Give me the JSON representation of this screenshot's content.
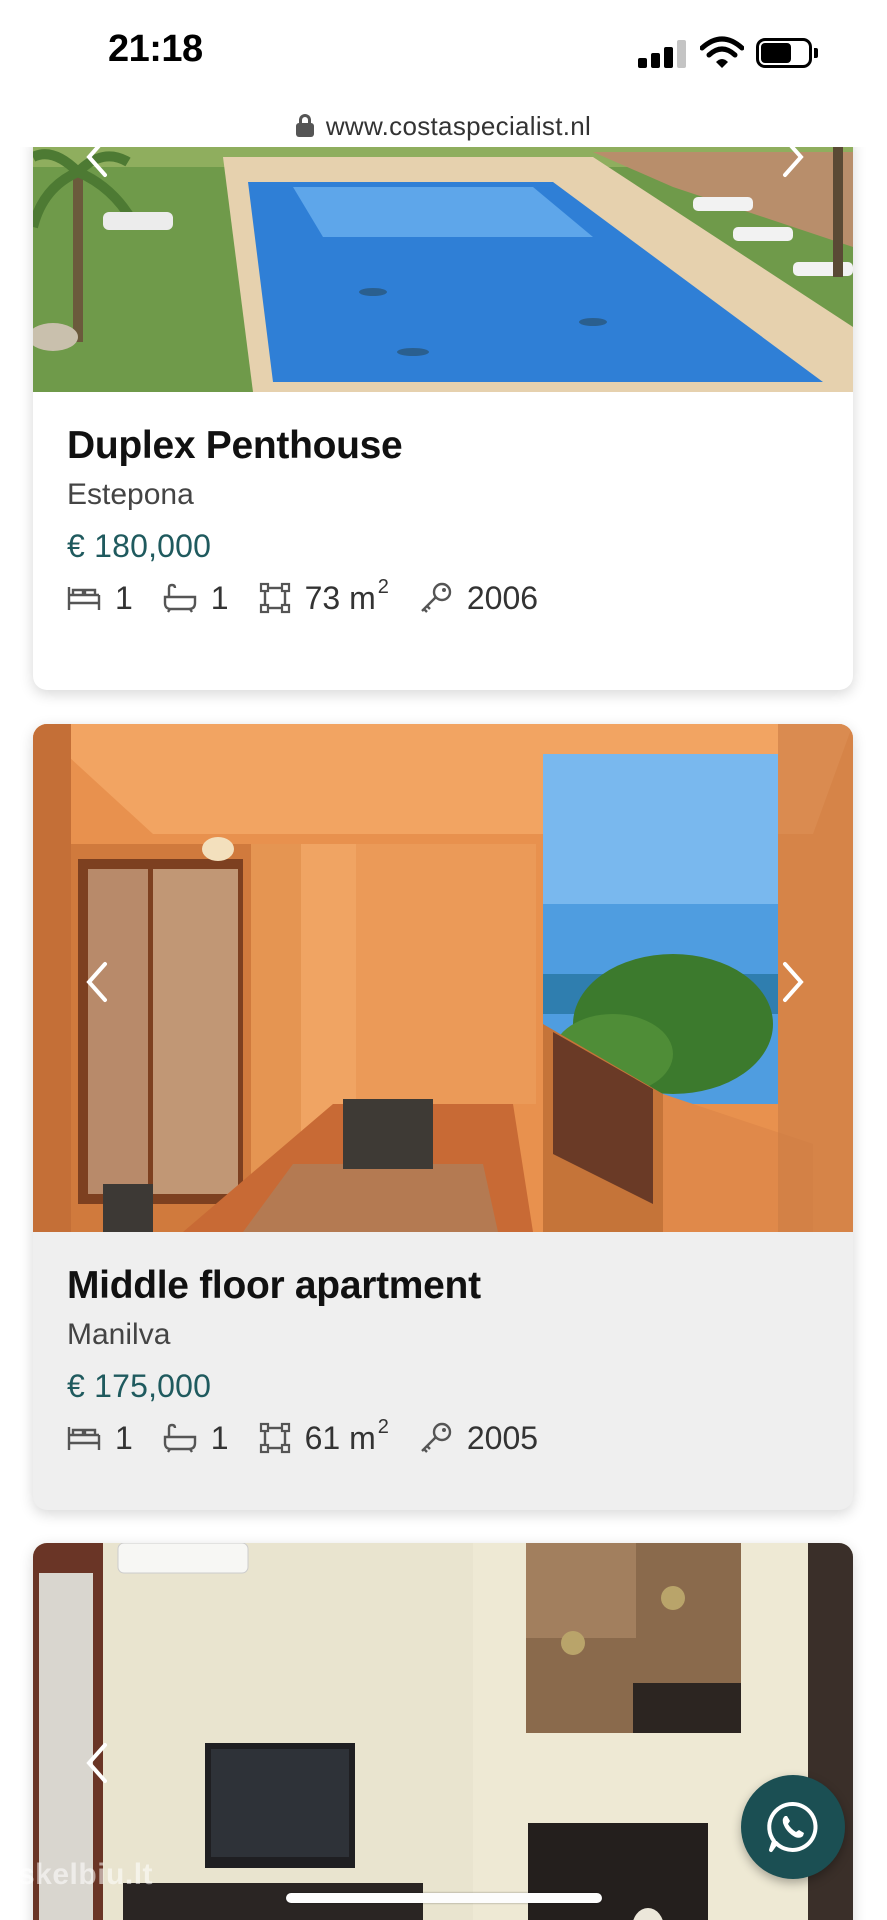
{
  "status_bar": {
    "time": "21:18"
  },
  "browser": {
    "url": "www.costaspecialist.nl"
  },
  "listings": [
    {
      "title": "Duplex Penthouse",
      "location": "Estepona",
      "price": "€ 180,000",
      "bedrooms": "1",
      "bathrooms": "1",
      "area": "73 m",
      "area_unit_exp": "2",
      "year": "2006"
    },
    {
      "title": "Middle floor apartment",
      "location": "Manilva",
      "price": "€ 175,000",
      "bedrooms": "1",
      "bathrooms": "1",
      "area": "61 m",
      "area_unit_exp": "2",
      "year": "2005"
    }
  ],
  "icons": {
    "bed": "bed-icon",
    "bath": "bathtub-icon",
    "area": "area-icon",
    "key": "key-icon",
    "prev": "chevron-left-icon",
    "next": "chevron-right-icon",
    "whatsapp": "whatsapp-icon"
  },
  "watermark": "skelbiu.lt",
  "colors": {
    "price": "#1f5a5e",
    "fab": "#1b4f53"
  }
}
